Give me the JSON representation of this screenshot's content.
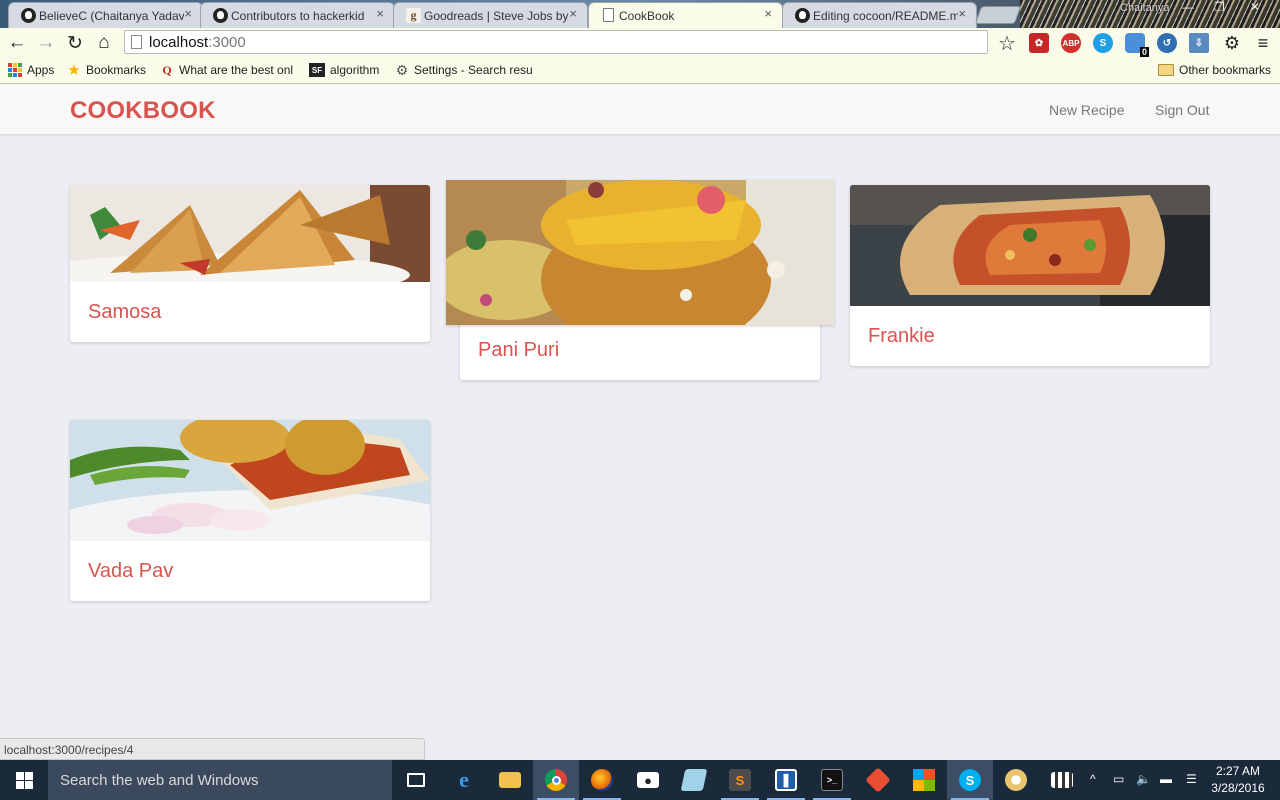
{
  "browser": {
    "tabs": [
      {
        "title": "BelieveC (Chaitanya Yadav)",
        "icon": "github-icon"
      },
      {
        "title": "Contributors to hackerkid",
        "icon": "github-icon"
      },
      {
        "title": "Goodreads | Steve Jobs by",
        "icon": "goodreads-icon"
      },
      {
        "title": "CookBook",
        "icon": "page-icon",
        "active": true
      },
      {
        "title": "Editing cocoon/README.md",
        "icon": "github-icon"
      }
    ],
    "tab_close": "×",
    "profile_name": "Chaitanya",
    "address": {
      "host": "localhost",
      "port": ":3000"
    },
    "bookmarks": [
      {
        "label": "Apps",
        "icon": "apps-grid-icon"
      },
      {
        "label": "Bookmarks",
        "icon": "star-icon"
      },
      {
        "label": "What are the best onl",
        "icon": "quora-icon"
      },
      {
        "label": "algorithm",
        "icon": "sf-icon"
      },
      {
        "label": "Settings - Search resu",
        "icon": "gear-icon"
      }
    ],
    "other_bookmarks": "Other bookmarks",
    "extension_badge": "0",
    "status_url": "localhost:3000/recipes/4"
  },
  "app": {
    "brand": "COOKBOOK",
    "nav": {
      "new_recipe": "New Recipe",
      "sign_out": "Sign Out"
    },
    "recipes": [
      {
        "name": "Samosa"
      },
      {
        "name": "Pani Puri"
      },
      {
        "name": "Frankie"
      },
      {
        "name": "Vada Pav"
      }
    ]
  },
  "taskbar": {
    "search_placeholder": "Search the web and Windows",
    "time": "2:27 AM",
    "date": "3/28/2016"
  },
  "colors": {
    "brand_red": "#d9534f",
    "page_bg": "#eceef3",
    "taskbar_bg": "#1b2a3a"
  }
}
